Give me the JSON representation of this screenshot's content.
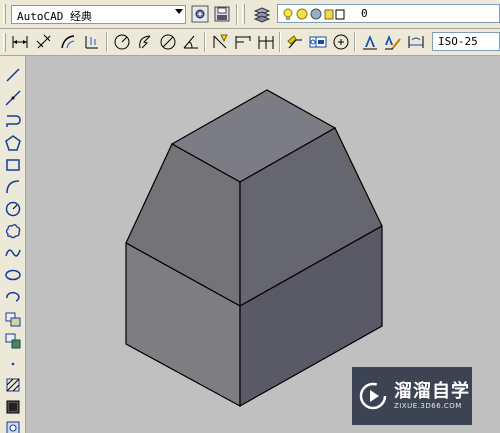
{
  "toolbars": {
    "workspace_combo": {
      "value": "AutoCAD 经典"
    },
    "layer_combo": {
      "value": "0"
    },
    "dimstyle_combo": {
      "value": "ISO-25"
    }
  },
  "model_view": {
    "object": "3d-solid-shaded",
    "face_colors": {
      "top": "#7c7c84",
      "slope_left": "#747478",
      "slope_right": "#66666e",
      "lower_left": "#7d7d82",
      "lower_right": "#5a5a66",
      "background": "#c0c0c0"
    }
  },
  "watermark": {
    "title": "溜溜自学",
    "subtitle": "ZIXUE.3D66.COM"
  }
}
